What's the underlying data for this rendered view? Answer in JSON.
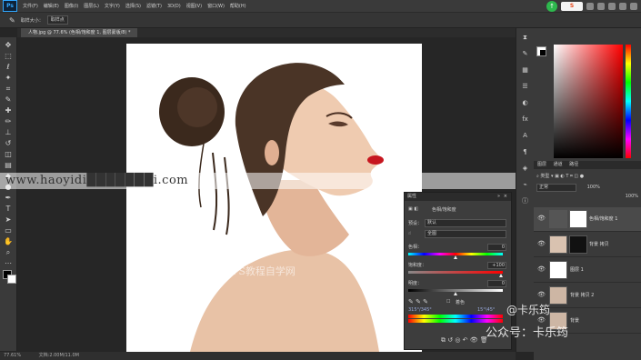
{
  "menubar": {
    "logo": "Ps",
    "items": [
      "文件(F)",
      "编辑(E)",
      "图像(I)",
      "图层(L)",
      "文字(Y)",
      "选择(S)",
      "滤镜(T)",
      "3D(D)",
      "视图(V)",
      "窗口(W)",
      "帮助(H)"
    ],
    "tray_logo": "S",
    "tray_badge": "↑"
  },
  "options": {
    "brush_size_label": "取样大小：",
    "brush_size_value": "取样点"
  },
  "document_tab": {
    "label": "人物.jpg @ 77.6% (色相/饱和度 1, 图层蒙版/8) *"
  },
  "canvas": {
    "site_watermark": "www.haoyidi███████i.com",
    "photo_caption": "PS教程自学网"
  },
  "statusbar": {
    "zoom": "77.61%",
    "doc_size": "文档:2.00M/11.0M"
  },
  "properties": {
    "title": "属性",
    "adjust_title": "色相/饱和度",
    "preset_label": "预设：",
    "preset_value": "默认",
    "channel_value": "全图",
    "hue_label": "色相：",
    "hue_value": "0",
    "hue_pct": 0.5,
    "saturation_label": "饱和度：",
    "saturation_value": "+100",
    "saturation_pct": 0.98,
    "lightness_label": "明度：",
    "lightness_value": "0",
    "lightness_pct": 0.5,
    "colorize_label": "着色",
    "range_left": "315°/345°",
    "range_right": "15°\\45°"
  },
  "panels": {
    "fg_color": "#ffffff",
    "bg_color": "#000000"
  },
  "layers": {
    "tabs": [
      "图层",
      "通道",
      "路径"
    ],
    "blend_mode": "正常",
    "opacity": "100%",
    "fill": "100%",
    "rows": [
      {
        "name": "色相/饱和度 1"
      },
      {
        "name": "背景 拷贝"
      },
      {
        "name": "图层 1"
      },
      {
        "name": "背景 拷贝 2"
      },
      {
        "name": "背景"
      }
    ]
  },
  "social": {
    "handle": "@卡乐筠",
    "account": "公众号：卡乐筠"
  }
}
